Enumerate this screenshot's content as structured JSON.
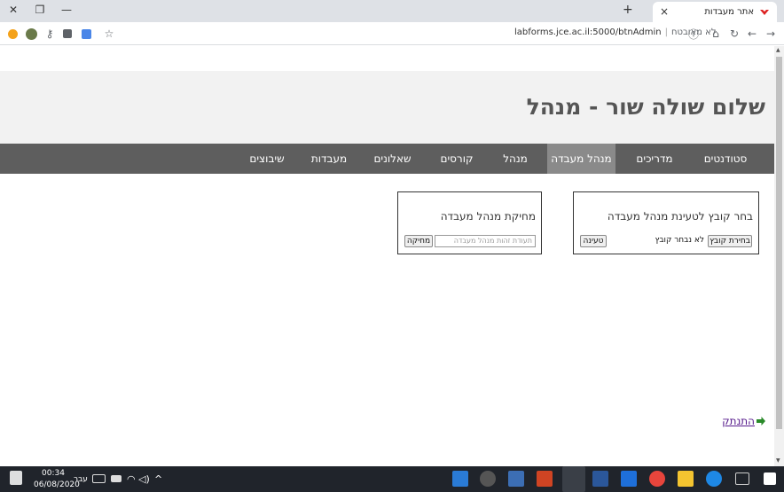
{
  "browser": {
    "tab_title": "אתר מעבדות",
    "new_tab_symbol": "+",
    "tab_close_symbol": "×",
    "url_insecure_label": "לא מאובטח",
    "url": "labforms.jce.ac.il:5000/btnAdmin"
  },
  "header": {
    "title": "שלום שולה שור - מנהל"
  },
  "nav": {
    "items": [
      {
        "label": "סטודנטים"
      },
      {
        "label": "מדריכים"
      },
      {
        "label": "מנהל מעבדה"
      },
      {
        "label": "מנהל"
      },
      {
        "label": "קורסים"
      },
      {
        "label": "שאלונים"
      },
      {
        "label": "מעבדות"
      },
      {
        "label": "שיבוצים"
      }
    ],
    "active_index": 2
  },
  "upload_panel": {
    "title": "בחר קובץ לטעינת מנהל מעבדה",
    "choose_button": "בחירת קובץ",
    "no_file_text": "לא נבחר קובץ",
    "load_button": "טעינה"
  },
  "delete_panel": {
    "title": "מחיקת מנהל מעבדה",
    "id_placeholder": "תעודת זהות מנהל מעבדה",
    "delete_button": "מחיקה"
  },
  "logout": {
    "label": "התנתק"
  },
  "taskbar": {
    "time": "00:34",
    "date": "06/08/2020",
    "language": "עבר"
  },
  "colors": {
    "nav_bg": "#5e5e5e",
    "nav_active": "#8a8a8a",
    "header_band": "#f2f2f2",
    "taskbar_bg": "#20242b"
  }
}
